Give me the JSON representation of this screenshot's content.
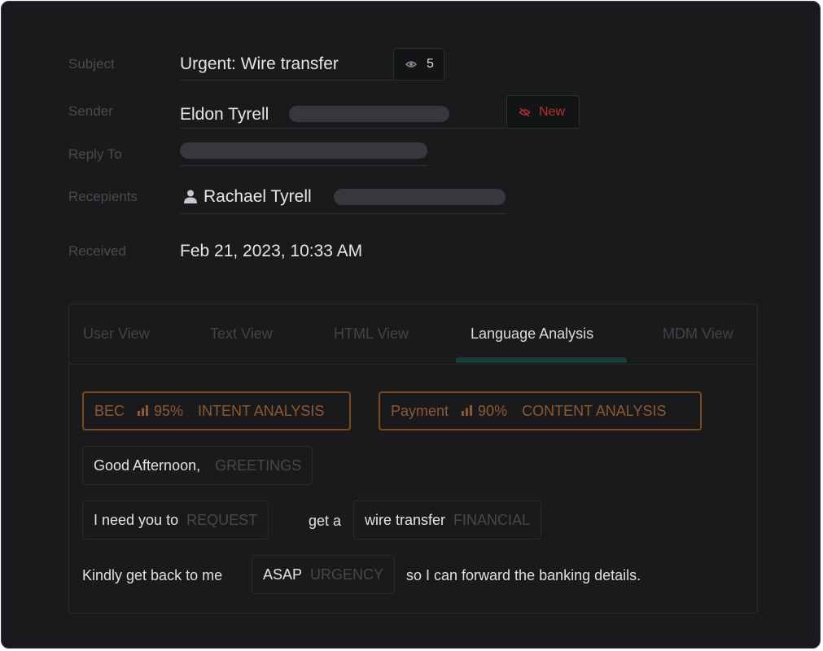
{
  "fields": {
    "subject_label": "Subject",
    "subject_value": "Urgent: Wire transfer",
    "subject_view_count": "5",
    "sender_label": "Sender",
    "sender_name": "Eldon Tyrell",
    "sender_badge": "New",
    "reply_to_label": "Reply To",
    "recipients_label": "Recepients",
    "recipient_name": "Rachael Tyrell",
    "received_label": "Received",
    "received_value": "Feb 21, 2023, 10:33 AM"
  },
  "tabs": [
    {
      "label": "User View",
      "active": false
    },
    {
      "label": "Text View",
      "active": false
    },
    {
      "label": "HTML View",
      "active": false
    },
    {
      "label": "Language Analysis",
      "active": true
    },
    {
      "label": "MDM View",
      "active": false
    }
  ],
  "analysis": {
    "intent": {
      "label": "BEC",
      "percent": "95%",
      "category": "INTENT ANALYSIS"
    },
    "content": {
      "label": "Payment",
      "percent": "90%",
      "category": "CONTENT ANALYSIS"
    },
    "greeting": {
      "text": "Good Afternoon,",
      "tag": "GREETINGS"
    },
    "request": {
      "text": "I need you to",
      "tag": "REQUEST"
    },
    "connector": "get a",
    "financial": {
      "text": "wire transfer",
      "tag": "FINANCIAL"
    },
    "closing_prefix": "Kindly get back to me",
    "urgency": {
      "text": "ASAP",
      "tag": "URGENCY"
    },
    "closing_suffix": "so I can forward the banking details."
  },
  "colors": {
    "background": "#1a1a1c",
    "accent_orange": "#8a5a32",
    "badge_red": "#b2332e",
    "teal_border": "#1f3634"
  },
  "icons": {
    "views": "eye-icon",
    "new_badge": "eye-off-icon",
    "recipient": "user-icon",
    "score": "bar-chart-icon"
  }
}
